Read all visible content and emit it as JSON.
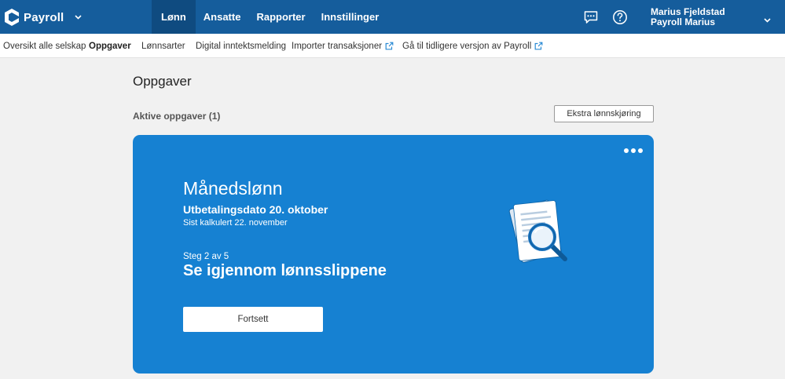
{
  "app": {
    "name": "Payroll"
  },
  "nav": {
    "items": [
      {
        "label": "Lønn",
        "active": true
      },
      {
        "label": "Ansatte",
        "active": false
      },
      {
        "label": "Rapporter",
        "active": false
      },
      {
        "label": "Innstillinger",
        "active": false
      }
    ]
  },
  "header_icons": [
    "chat-icon",
    "help-icon"
  ],
  "user": {
    "name": "Marius Fjeldstad",
    "company": "Payroll Marius"
  },
  "subnav": {
    "items": [
      {
        "label": "Oversikt alle selskap",
        "active": false,
        "external": false
      },
      {
        "label": "Oppgaver",
        "active": true,
        "external": false
      },
      {
        "label": "Lønnsarter",
        "active": false,
        "external": false
      },
      {
        "label": "Digital inntektsmelding",
        "active": false,
        "external": false
      },
      {
        "label": "Importer transaksjoner",
        "active": false,
        "external": true
      },
      {
        "label": "Gå til tidligere versjon av Payroll",
        "active": false,
        "external": true
      }
    ]
  },
  "page": {
    "title": "Oppgaver",
    "section_title": "Aktive oppgaver (1)",
    "extra_button": "Ekstra lønnskjøring"
  },
  "task": {
    "title": "Månedslønn",
    "payout_date": "Utbetalingsdato 20. oktober",
    "last_calculated": "Sist kalkulert 22. november",
    "step": "Steg 2 av 5",
    "step_name": "Se igjennom lønnsslippene",
    "button": "Fortsett"
  },
  "colors": {
    "header": "#155d9c",
    "header_active": "#0f4b80",
    "card": "#1681d2",
    "link": "#2a8ad4",
    "background": "#f1f1f1"
  }
}
